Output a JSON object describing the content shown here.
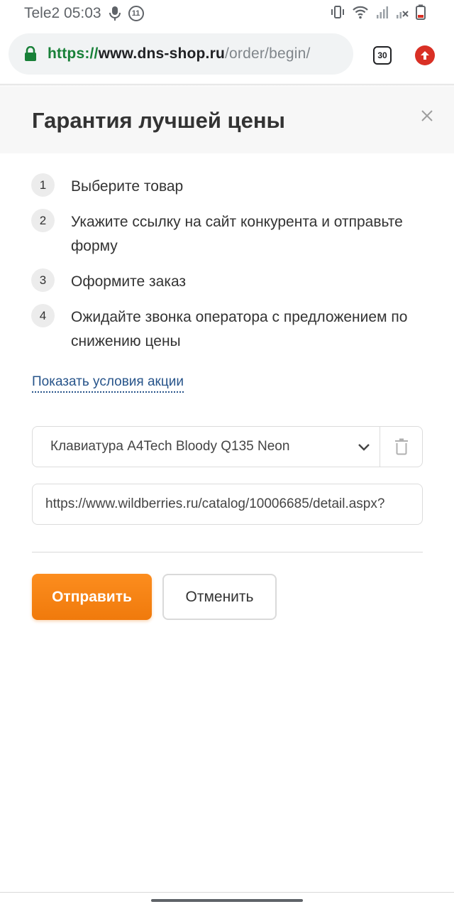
{
  "status_bar": {
    "carrier_time": "Tele2 05:03",
    "notification_count": "11"
  },
  "browser": {
    "url_scheme": "https://",
    "url_host": "www.dns-shop.ru",
    "url_path": "/order/begin/",
    "tab_count": "30"
  },
  "modal": {
    "title": "Гарантия лучшей цены",
    "steps": [
      {
        "num": "1",
        "text": "Выберите товар"
      },
      {
        "num": "2",
        "text": "Укажите ссылку на сайт конкурента и отправьте форму"
      },
      {
        "num": "3",
        "text": "Оформите заказ"
      },
      {
        "num": "4",
        "text": "Ожидайте звонка оператора с предложением по снижению цены"
      }
    ],
    "conditions_link": "Показать условия акции",
    "product_select_value": "Клавиатура A4Tech Bloody Q135 Neon",
    "competitor_url_value": "https://www.wildberries.ru/catalog/10006685/detail.aspx?",
    "submit_label": "Отправить",
    "cancel_label": "Отменить"
  },
  "colors": {
    "accent_orange": "#f58214",
    "link_blue": "#27548a",
    "secure_green": "#188038",
    "header_bg": "#f7f7f7"
  }
}
